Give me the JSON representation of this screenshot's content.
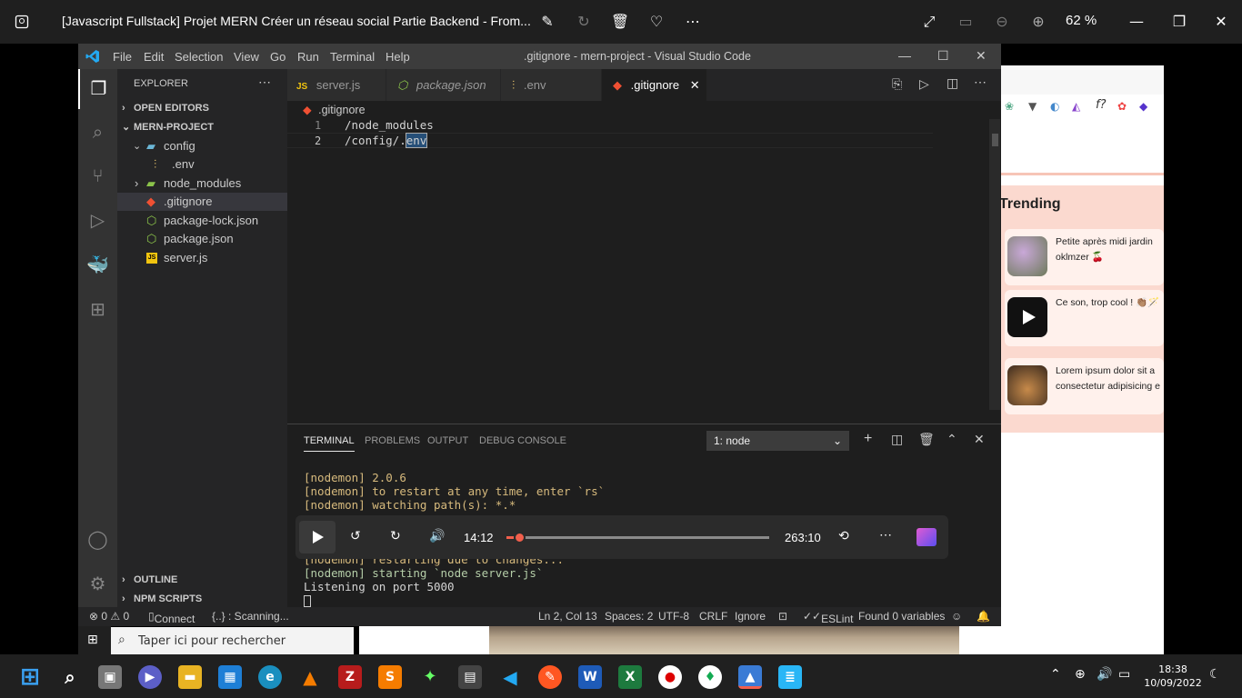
{
  "photos": {
    "title": "[Javascript Fullstack] Projet MERN  Créer un réseau social  Partie Backend - From...",
    "zoom": "62 %"
  },
  "vscode": {
    "window_title": ".gitignore - mern-project - Visual Studio Code",
    "menu": [
      "File",
      "Edit",
      "Selection",
      "View",
      "Go",
      "Run",
      "Terminal",
      "Help"
    ],
    "explorer_title": "EXPLORER",
    "sections": {
      "open_editors": "OPEN EDITORS",
      "project": "MERN-PROJECT",
      "outline": "OUTLINE",
      "npm": "NPM SCRIPTS"
    },
    "tree": [
      {
        "label": "config",
        "icon": "folder-open-icon"
      },
      {
        "label": ".env",
        "icon": "env-file-icon"
      },
      {
        "label": "node_modules",
        "icon": "folder-icon"
      },
      {
        "label": ".gitignore",
        "icon": "git-file-icon"
      },
      {
        "label": "package-lock.json",
        "icon": "node-file-icon"
      },
      {
        "label": "package.json",
        "icon": "node-file-icon"
      },
      {
        "label": "server.js",
        "icon": "js-file-icon"
      }
    ],
    "tabs": [
      {
        "label": "server.js",
        "icon": "JS"
      },
      {
        "label": "package.json",
        "icon": "⬡"
      },
      {
        "label": ".env",
        "icon": "⫶"
      },
      {
        "label": ".gitignore",
        "icon": "◆"
      }
    ],
    "breadcrumb": ".gitignore",
    "code_lines": [
      {
        "n": "1",
        "text": "/node_modules"
      },
      {
        "n": "2",
        "text": "/config/.",
        "highlight": "env"
      }
    ],
    "panel_tabs": [
      "TERMINAL",
      "PROBLEMS",
      "OUTPUT",
      "DEBUG CONSOLE"
    ],
    "terminal_select": "1: node",
    "terminal_lines": [
      {
        "text": "[nodemon] 2.0.6",
        "color": "#d7ba7d"
      },
      {
        "text": "[nodemon] to restart at any time, enter `rs`",
        "color": "#d7ba7d"
      },
      {
        "text": "[nodemon] watching path(s): *.*",
        "color": "#d7ba7d"
      }
    ],
    "terminal_lines_bottom": [
      {
        "text": "[nodemon] restarting due to changes...",
        "color": "#d7ba7d"
      },
      {
        "text": "[nodemon] starting `node server.js`",
        "color": "#b5cea8"
      },
      {
        "text": "Listening on port 5000",
        "color": "#d4d4d4"
      }
    ],
    "status": {
      "errors": "⊗ 0 ⚠ 0",
      "connect": "Connect",
      "scanning": "{..} : Scanning...",
      "position": "Ln 2, Col 13",
      "spaces": "Spaces: 2",
      "encoding": "UTF-8",
      "eol": "CRLF",
      "lang": "Ignore",
      "eslint": "ESLint",
      "vars": "Found 0 variables"
    }
  },
  "media": {
    "current": "14:12",
    "total": "263:10",
    "progress": 0.04
  },
  "browser": {
    "trending_title": "Trending",
    "cards": [
      {
        "line1": "Petite après midi jardin",
        "line2": "oklmzer 🍒"
      },
      {
        "line1": "Ce son, trop cool ! 👏🏽🪄",
        "line2": ""
      },
      {
        "line1": "Lorem ipsum dolor sit a",
        "line2": "consectetur adipisicing e"
      }
    ]
  },
  "taskbar": {
    "search_placeholder": "Taper ici pour rechercher",
    "time": "18:38",
    "date": "10/09/2022"
  },
  "colors": {
    "vscode_accent": "#007acc",
    "trending_bg": "#fbd9cf",
    "media_accent": "#f25f4c"
  }
}
